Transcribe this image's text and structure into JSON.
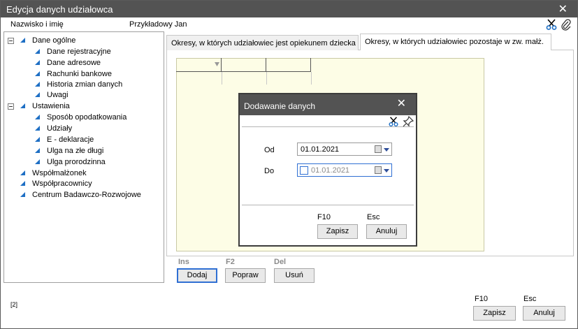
{
  "window": {
    "title": "Edycja danych udziałowca",
    "close_icon": "close-icon"
  },
  "header": {
    "name_label": "Nazwisko i imię",
    "name_value": "Przykładowy Jan",
    "icons": [
      "scissors-icon",
      "paperclip-icon"
    ]
  },
  "tree": {
    "groups": [
      {
        "label": "Dane ogólne",
        "items": [
          "Dane rejestracyjne",
          "Dane adresowe",
          "Rachunki bankowe",
          "Historia zmian danych",
          "Uwagi"
        ]
      },
      {
        "label": "Ustawienia",
        "items": [
          "Sposób opodatkowania",
          "Udziały",
          "E - deklaracje",
          "Ulga na złe długi",
          "Ulga prorodzinna"
        ]
      }
    ],
    "top_items": [
      "Współmałżonek",
      "Współpracownicy",
      "Centrum Badawczo-Rozwojowe"
    ]
  },
  "tabs": [
    {
      "label": "Okresy, w których udziałowiec jest opiekunem dziecka",
      "active": false
    },
    {
      "label": "Okresy, w których udziałowiec pozostaje w zw. małż.",
      "active": true
    }
  ],
  "grid_actions": {
    "add": {
      "key": "Ins",
      "label": "Dodaj"
    },
    "edit": {
      "key": "F2",
      "label": "Popraw"
    },
    "delete": {
      "key": "Del",
      "label": "Usuń"
    }
  },
  "dialog": {
    "title": "Dodawanie danych",
    "icons": [
      "scissors-icon",
      "pin-icon"
    ],
    "from_label": "Od",
    "from_value": "01.01.2021",
    "to_label": "Do",
    "to_value": "01.01.2021",
    "save": {
      "key": "F10",
      "label": "Zapisz"
    },
    "cancel": {
      "key": "Esc",
      "label": "Anuluj"
    }
  },
  "footer": {
    "save": {
      "key": "F10",
      "label": "Zapisz"
    },
    "cancel": {
      "key": "Esc",
      "label": "Anuluj"
    },
    "status_text": "[2]"
  },
  "colors": {
    "titlebar": "#535353",
    "tree_triangle": "#1e6fc4",
    "grid_background": "#fdfde6",
    "focus_border": "#2f6fd3"
  }
}
